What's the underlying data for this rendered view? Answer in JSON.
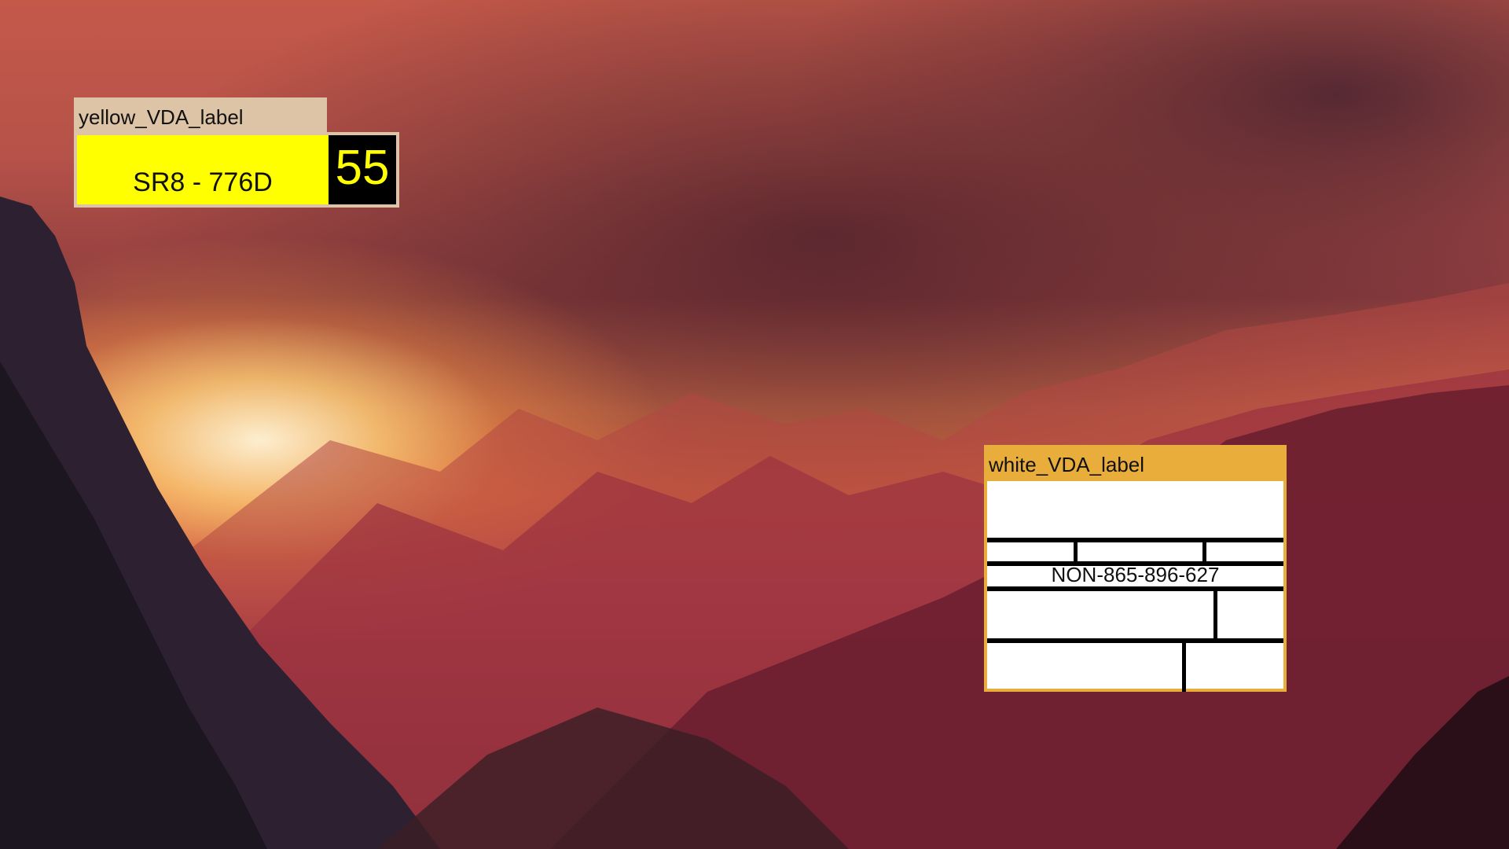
{
  "desktop": {
    "wallpaper": "sunset-mountain-valley"
  },
  "yellow_label_window": {
    "title": "yellow_VDA_label",
    "plate_text": "SR8 - 776D",
    "number": "55",
    "colors": {
      "title_bar": "#dec4a6",
      "plate": "#ffff00",
      "number_bg": "#000000",
      "number_fg": "#ffff00"
    }
  },
  "white_label_window": {
    "title": "white_VDA_label",
    "id_text": "NON-865-896-627",
    "colors": {
      "title_bar": "#e8ad3a",
      "body": "#ffffff",
      "lines": "#000000"
    }
  }
}
